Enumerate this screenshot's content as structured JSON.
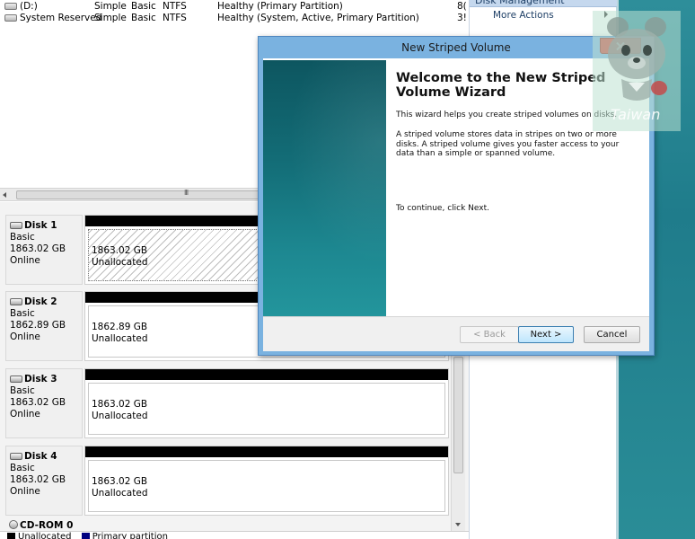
{
  "volumes": [
    {
      "name": "(D:)",
      "layout": "Simple",
      "type": "Basic",
      "fs": "NTFS",
      "status": "Healthy (Primary Partition)",
      "extra": "8("
    },
    {
      "name": "System Reserved",
      "layout": "Simple",
      "type": "Basic",
      "fs": "NTFS",
      "status": "Healthy (System, Active, Primary Partition)",
      "extra": "3!"
    }
  ],
  "hscroll_grip": "III",
  "actions": {
    "header": "Disk Management",
    "more_actions": "More Actions"
  },
  "disks": [
    {
      "title": "Disk 1",
      "type": "Basic",
      "size": "1863.02 GB",
      "state": "Online",
      "part_size": "1863.02 GB",
      "part_status": "Unallocated"
    },
    {
      "title": "Disk 2",
      "type": "Basic",
      "size": "1862.89 GB",
      "state": "Online",
      "part_size": "1862.89 GB",
      "part_status": "Unallocated"
    },
    {
      "title": "Disk 3",
      "type": "Basic",
      "size": "1863.02 GB",
      "state": "Online",
      "part_size": "1863.02 GB",
      "part_status": "Unallocated"
    },
    {
      "title": "Disk 4",
      "type": "Basic",
      "size": "1863.02 GB",
      "state": "Online",
      "part_size": "1863.02 GB",
      "part_status": "Unallocated"
    }
  ],
  "cdrom": "CD-ROM 0",
  "legend": [
    {
      "label": "Unallocated",
      "color": "#000000"
    },
    {
      "label": "Primary partition",
      "color": "#000080"
    }
  ],
  "watermark": "Taiwan",
  "dialog": {
    "title": "New Striped Volume",
    "heading": "Welcome to the New Striped Volume Wizard",
    "p1": "This wizard helps you create striped volumes on disks.",
    "p2": "A striped volume stores data in stripes on two or more disks. A striped volume gives you faster access to your data than a simple or spanned volume.",
    "p3": "To continue, click Next.",
    "back": "< Back",
    "next": "Next >",
    "cancel": "Cancel"
  }
}
